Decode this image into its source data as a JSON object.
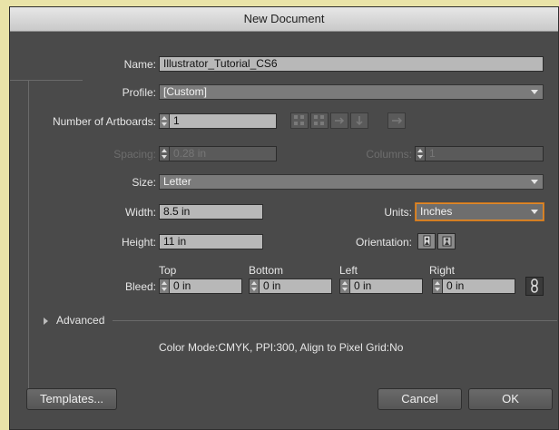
{
  "window": {
    "title": "New Document"
  },
  "name": {
    "label": "Name:",
    "value": "Illustrator_Tutorial_CS6"
  },
  "profile": {
    "label": "Profile:",
    "value": "[Custom]"
  },
  "artboards": {
    "label": "Number of Artboards:",
    "value": "1"
  },
  "spacing": {
    "label": "Spacing:",
    "value": "0.28 in"
  },
  "columns": {
    "label": "Columns:",
    "value": "1"
  },
  "size": {
    "label": "Size:",
    "value": "Letter"
  },
  "width": {
    "label": "Width:",
    "value": "8.5 in"
  },
  "units": {
    "label": "Units:",
    "value": "Inches"
  },
  "height": {
    "label": "Height:",
    "value": "11 in"
  },
  "orientation": {
    "label": "Orientation:"
  },
  "bleed": {
    "label": "Bleed:",
    "top": {
      "label": "Top",
      "value": "0 in"
    },
    "bottom": {
      "label": "Bottom",
      "value": "0 in"
    },
    "left": {
      "label": "Left",
      "value": "0 in"
    },
    "right": {
      "label": "Right",
      "value": "0 in"
    }
  },
  "advanced": {
    "label": "Advanced"
  },
  "info": {
    "text": "Color Mode:CMYK, PPI:300, Align to Pixel Grid:No"
  },
  "buttons": {
    "templates": "Templates...",
    "cancel": "Cancel",
    "ok": "OK"
  },
  "icons": {
    "arrangement": [
      "grid-by-row-icon",
      "grid-by-column-icon",
      "arrange-by-row-icon",
      "arrange-by-column-icon",
      "right-to-left-icon"
    ],
    "orientation": [
      "portrait-icon",
      "landscape-icon"
    ],
    "bleed_link": "link-icon",
    "advanced_toggle": "disclosure-triangle-icon"
  }
}
